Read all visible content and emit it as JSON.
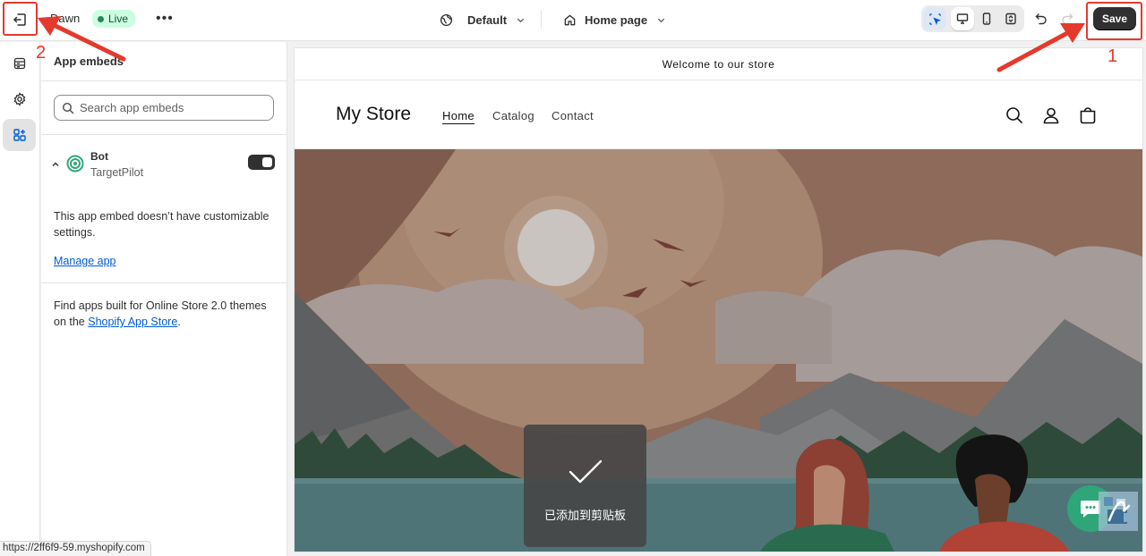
{
  "topbar": {
    "theme_name": "Dawn",
    "live_label": "Live",
    "more_label": "•••",
    "theme_selector": "Default",
    "page_selector": "Home page",
    "save_label": "Save"
  },
  "sidebar_panel": {
    "title": "App embeds",
    "search_placeholder": "Search app embeds",
    "embed": {
      "name": "Bot",
      "provider": "TargetPilot",
      "enabled": true
    },
    "description": "This app embed doesn’t have customizable settings.",
    "manage_link": "Manage app",
    "find_text_before": "Find apps built for Online Store 2.0 themes on the ",
    "find_link": "Shopify App Store",
    "find_text_after": "."
  },
  "preview": {
    "announcement": "Welcome to our store",
    "store_name": "My Store",
    "nav": [
      "Home",
      "Catalog",
      "Contact"
    ]
  },
  "toast": {
    "message": "已添加到剪贴板"
  },
  "status_bar": {
    "url": "https://2ff6f9-59.myshopify.com"
  },
  "annotations": {
    "label_1": "1",
    "label_2": "2",
    "color": "#e5392c"
  },
  "colors": {
    "live_badge_bg": "#cdfee1",
    "save_bg": "#303030",
    "link": "#005bd3",
    "embed_icon": "#2fa679"
  }
}
